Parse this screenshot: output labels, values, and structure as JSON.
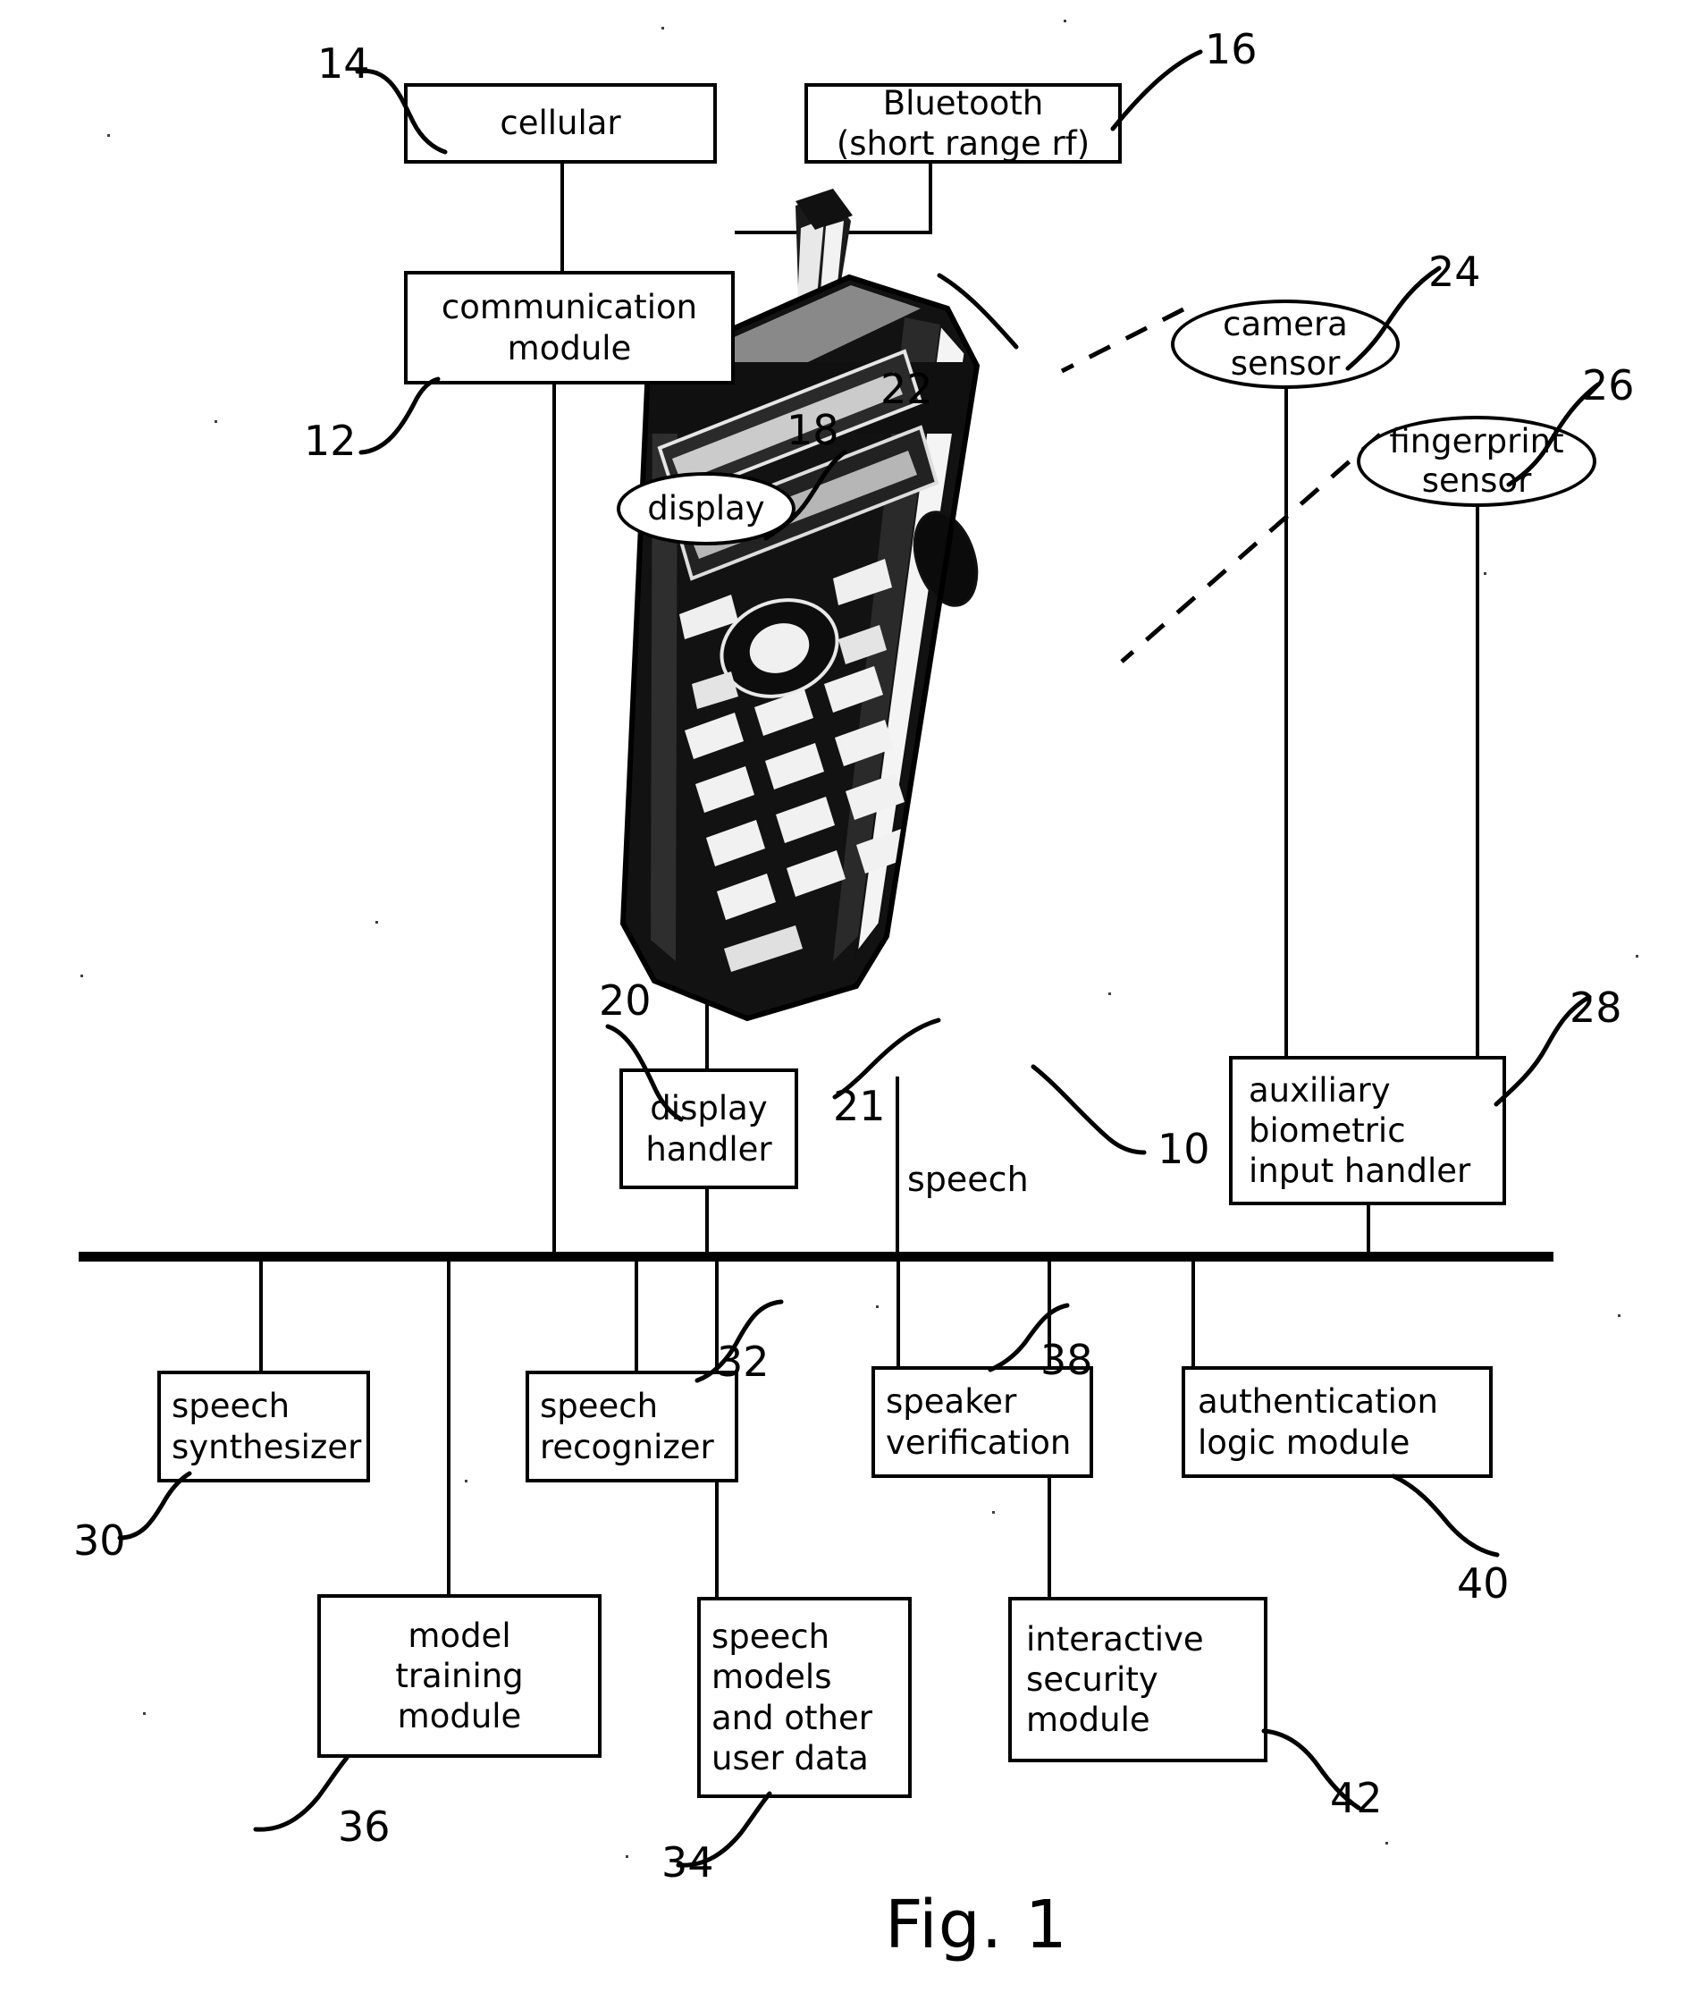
{
  "figure": {
    "caption": "Fig. 1",
    "title": "Fig. 1"
  },
  "blocks": {
    "cellular": {
      "label": "cellular",
      "ref": "14"
    },
    "bluetooth": {
      "label": "Bluetooth\n(short range rf)",
      "line1": "Bluetooth",
      "line2": "(short range rf)",
      "ref": "16"
    },
    "communication_module": {
      "line1": "communication",
      "line2": "module",
      "ref": "12"
    },
    "display_handler": {
      "line1": "display",
      "line2": "handler",
      "ref": "20"
    },
    "auxiliary_biometric_input_handler": {
      "line1": "auxiliary",
      "line2": "biometric",
      "line3": "input handler",
      "ref": "28"
    },
    "speech_synthesizer": {
      "line1": "speech",
      "line2": "synthesizer",
      "ref": "30"
    },
    "speech_recognizer": {
      "line1": "speech",
      "line2": "recognizer",
      "ref": "32"
    },
    "speaker_verification": {
      "line1": "speaker",
      "line2": "verification",
      "ref": "38"
    },
    "authentication_logic_module": {
      "line1": "authentication",
      "line2": "logic module",
      "ref": "40"
    },
    "model_training_module": {
      "line1": "model",
      "line2": "training",
      "line3": "module",
      "ref": "36"
    },
    "speech_models_user_data": {
      "line1": "speech",
      "line2": "models",
      "line3": "and other",
      "line4": "user data",
      "ref": "34"
    },
    "interactive_security_module": {
      "line1": "interactive",
      "line2": "security",
      "line3": "module",
      "ref": "42"
    }
  },
  "callouts": {
    "display": {
      "label": "display",
      "ref": "18"
    },
    "camera_sensor": {
      "line1": "camera",
      "line2": "sensor",
      "ref": "24"
    },
    "fingerprint_sensor": {
      "line1": "fingerprint",
      "line2": "sensor",
      "ref": "26"
    }
  },
  "annotations": {
    "antenna_ref": "22",
    "speech_line_ref": "21",
    "speech_label": "speech",
    "device_ref": "10"
  },
  "colors": {
    "ink": "#000000",
    "paper": "#ffffff"
  }
}
